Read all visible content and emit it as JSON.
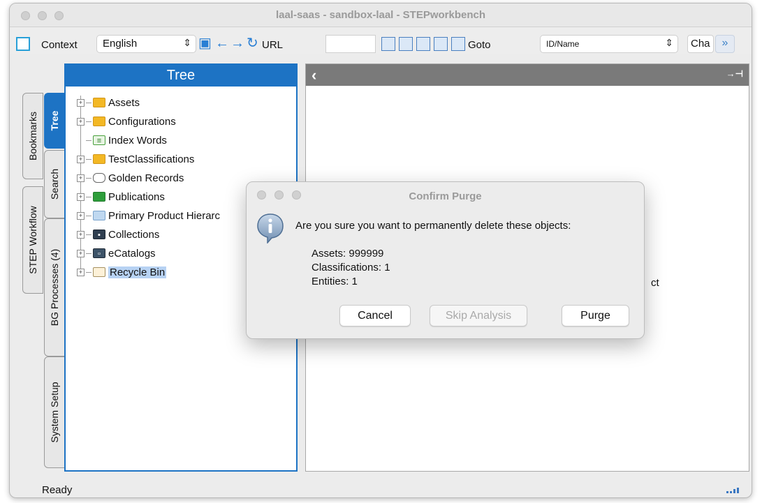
{
  "window": {
    "title": "laal-saas - sandbox-laal - STEPworkbench"
  },
  "toolbar": {
    "context_label": "Context",
    "language_value": "English",
    "url_label": "URL",
    "url_value": "",
    "goto_label": "Goto",
    "goto_select_value": "ID/Name",
    "cha_label": "Cha"
  },
  "side_tabs": {
    "bookmarks": "Bookmarks",
    "tree": "Tree",
    "search": "Search",
    "step_workflow": "STEP Workflow",
    "bg_processes": "BG Processes (4)",
    "system_setup": "System Setup"
  },
  "tree": {
    "header": "Tree",
    "items": [
      {
        "label": "Assets",
        "icon": "folder-icon"
      },
      {
        "label": "Configurations",
        "icon": "folder-icon"
      },
      {
        "label": "Index Words",
        "icon": "index-words-icon"
      },
      {
        "label": "TestClassifications",
        "icon": "folder-icon"
      },
      {
        "label": "Golden Records",
        "icon": "golden-records-icon"
      },
      {
        "label": "Publications",
        "icon": "green-folder-icon"
      },
      {
        "label": "Primary Product Hierarc",
        "icon": "blue-folder-icon"
      },
      {
        "label": "Collections",
        "icon": "collections-icon"
      },
      {
        "label": "eCatalogs",
        "icon": "ecatalogs-icon"
      },
      {
        "label": "Recycle Bin",
        "icon": "recycle-bin-icon",
        "selected": true
      }
    ]
  },
  "content": {
    "partial_text": "ct"
  },
  "status": {
    "text": "Ready"
  },
  "dialog": {
    "title": "Confirm Purge",
    "message": "Are you sure you want to permanently delete these objects:",
    "lines": [
      "Assets: 999999",
      "Classifications: 1",
      "Entities: 1"
    ],
    "buttons": {
      "cancel": "Cancel",
      "skip": "Skip Analysis",
      "purge": "Purge"
    }
  }
}
